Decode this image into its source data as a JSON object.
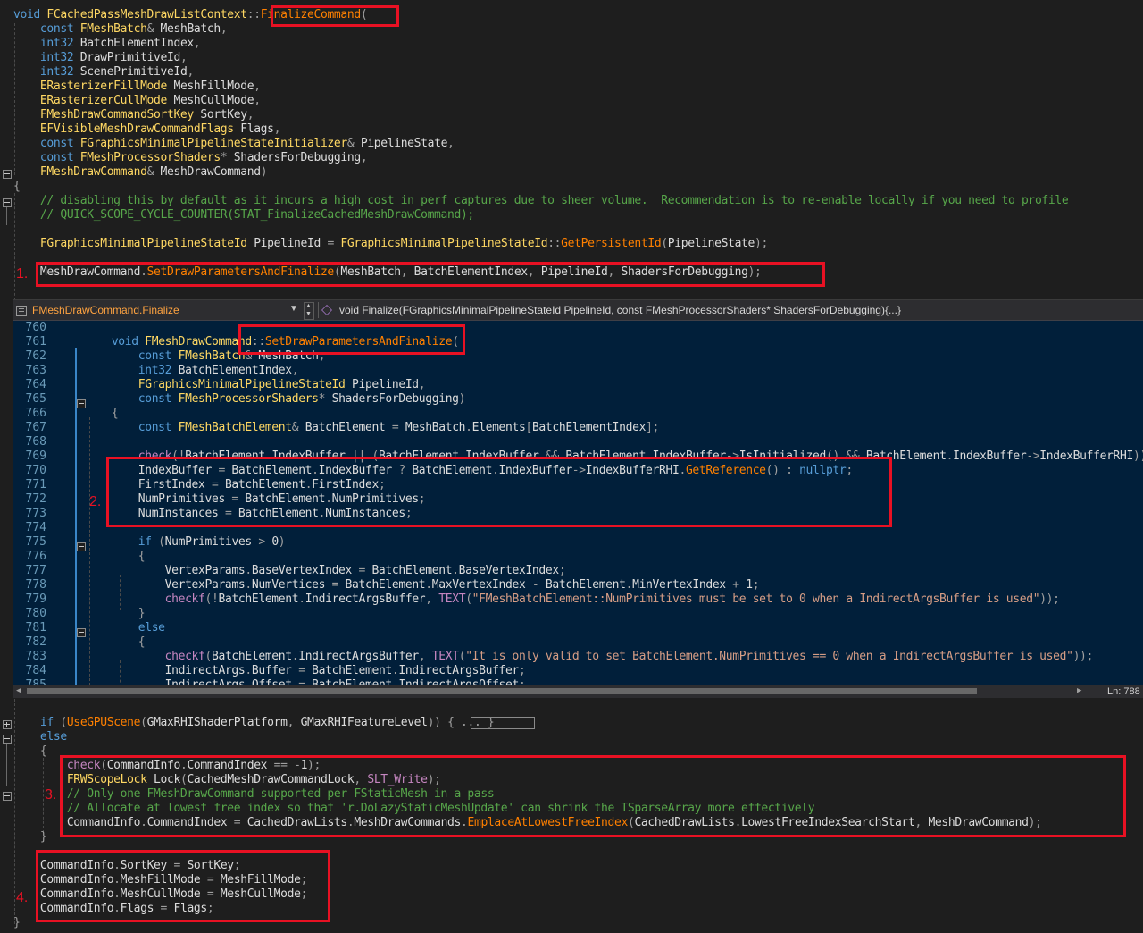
{
  "top_code": [
    "void FCachedPassMeshDrawListContext::FinalizeCommand(",
    "    const FMeshBatch& MeshBatch,",
    "    int32 BatchElementIndex,",
    "    int32 DrawPrimitiveId,",
    "    int32 ScenePrimitiveId,",
    "    ERasterizerFillMode MeshFillMode,",
    "    ERasterizerCullMode MeshCullMode,",
    "    FMeshDrawCommandSortKey SortKey,",
    "    EFVisibleMeshDrawCommandFlags Flags,",
    "    const FGraphicsMinimalPipelineStateInitializer& PipelineState,",
    "    const FMeshProcessorShaders* ShadersForDebugging,",
    "    FMeshDrawCommand& MeshDrawCommand)",
    "{",
    "    // disabling this by default as it incurs a high cost in perf captures due to sheer volume.  Recommendation is to re-enable locally if you need to profile",
    "    // QUICK_SCOPE_CYCLE_COUNTER(STAT_FinalizeCachedMeshDrawCommand);",
    "",
    "    FGraphicsMinimalPipelineStateId PipelineId = FGraphicsMinimalPipelineStateId::GetPersistentId(PipelineState);",
    "",
    "    MeshDrawCommand.SetDrawParametersAndFinalize(MeshBatch, BatchElementIndex, PipelineId, ShadersForDebugging);"
  ],
  "peek": {
    "left_dropdown": "FMeshDrawCommand.Finalize",
    "right_dropdown": "void Finalize(FGraphicsMinimalPipelineStateId PipelineId, const FMeshProcessorShaders* ShadersForDebugging){...}",
    "status": "Ln: 788",
    "line_numbers": [
      "760",
      "761",
      "762",
      "763",
      "764",
      "765",
      "766",
      "767",
      "768",
      "769",
      "770",
      "771",
      "772",
      "773",
      "774",
      "775",
      "776",
      "777",
      "778",
      "779",
      "780",
      "781",
      "782",
      "783",
      "784",
      "785"
    ],
    "code": [
      "",
      "void FMeshDrawCommand::SetDrawParametersAndFinalize(",
      "    const FMeshBatch& MeshBatch,",
      "    int32 BatchElementIndex,",
      "    FGraphicsMinimalPipelineStateId PipelineId,",
      "    const FMeshProcessorShaders* ShadersForDebugging)",
      "{",
      "    const FMeshBatchElement& BatchElement = MeshBatch.Elements[BatchElementIndex];",
      "",
      "    check(!BatchElement.IndexBuffer || (BatchElement.IndexBuffer && BatchElement.IndexBuffer->IsInitialized() && BatchElement.IndexBuffer->IndexBufferRHI));",
      "    IndexBuffer = BatchElement.IndexBuffer ? BatchElement.IndexBuffer->IndexBufferRHI.GetReference() : nullptr;",
      "    FirstIndex = BatchElement.FirstIndex;",
      "    NumPrimitives = BatchElement.NumPrimitives;",
      "    NumInstances = BatchElement.NumInstances;",
      "",
      "    if (NumPrimitives > 0)",
      "    {",
      "        VertexParams.BaseVertexIndex = BatchElement.BaseVertexIndex;",
      "        VertexParams.NumVertices = BatchElement.MaxVertexIndex - BatchElement.MinVertexIndex + 1;",
      "        checkf(!BatchElement.IndirectArgsBuffer, TEXT(\"FMeshBatchElement::NumPrimitives must be set to 0 when a IndirectArgsBuffer is used\"));",
      "    }",
      "    else",
      "    {",
      "        checkf(BatchElement.IndirectArgsBuffer, TEXT(\"It is only valid to set BatchElement.NumPrimitives == 0 when a IndirectArgsBuffer is used\"));",
      "        IndirectArgs.Buffer = BatchElement.IndirectArgsBuffer;",
      "        IndirectArgs.Offset = BatchElement.IndirectArgsOffset;"
    ]
  },
  "bottom_code": [
    "",
    "    if (UseGPUScene(GMaxRHIShaderPlatform, GMaxRHIFeatureLevel)) { ... }",
    "    else",
    "    {",
    "        check(CommandInfo.CommandIndex == -1);",
    "        FRWScopeLock Lock(CachedMeshDrawCommandLock, SLT_Write);",
    "        // Only one FMeshDrawCommand supported per FStaticMesh in a pass",
    "        // Allocate at lowest free index so that 'r.DoLazyStaticMeshUpdate' can shrink the TSparseArray more effectively",
    "        CommandInfo.CommandIndex = CachedDrawLists.MeshDrawCommands.EmplaceAtLowestFreeIndex(CachedDrawLists.LowestFreeIndexSearchStart, MeshDrawCommand);",
    "    }",
    "",
    "    CommandInfo.SortKey = SortKey;",
    "    CommandInfo.MeshFillMode = MeshFillMode;",
    "    CommandInfo.MeshCullMode = MeshCullMode;",
    "    CommandInfo.Flags = Flags;",
    "}"
  ],
  "markers": [
    "1.",
    "2.",
    "3.",
    "4."
  ],
  "colors": {
    "background": "#1e1e1e",
    "peek_background": "#011f3a",
    "keyword": "#569cd6",
    "type": "#ffd863",
    "function": "#ff8000",
    "comment": "#57a64a",
    "string": "#d69d85",
    "annotation": "#e81123"
  },
  "icons": {
    "peek_file_icon": "file-icon",
    "method_icon": "method-icon",
    "dropdown": "chevron-down-icon"
  }
}
